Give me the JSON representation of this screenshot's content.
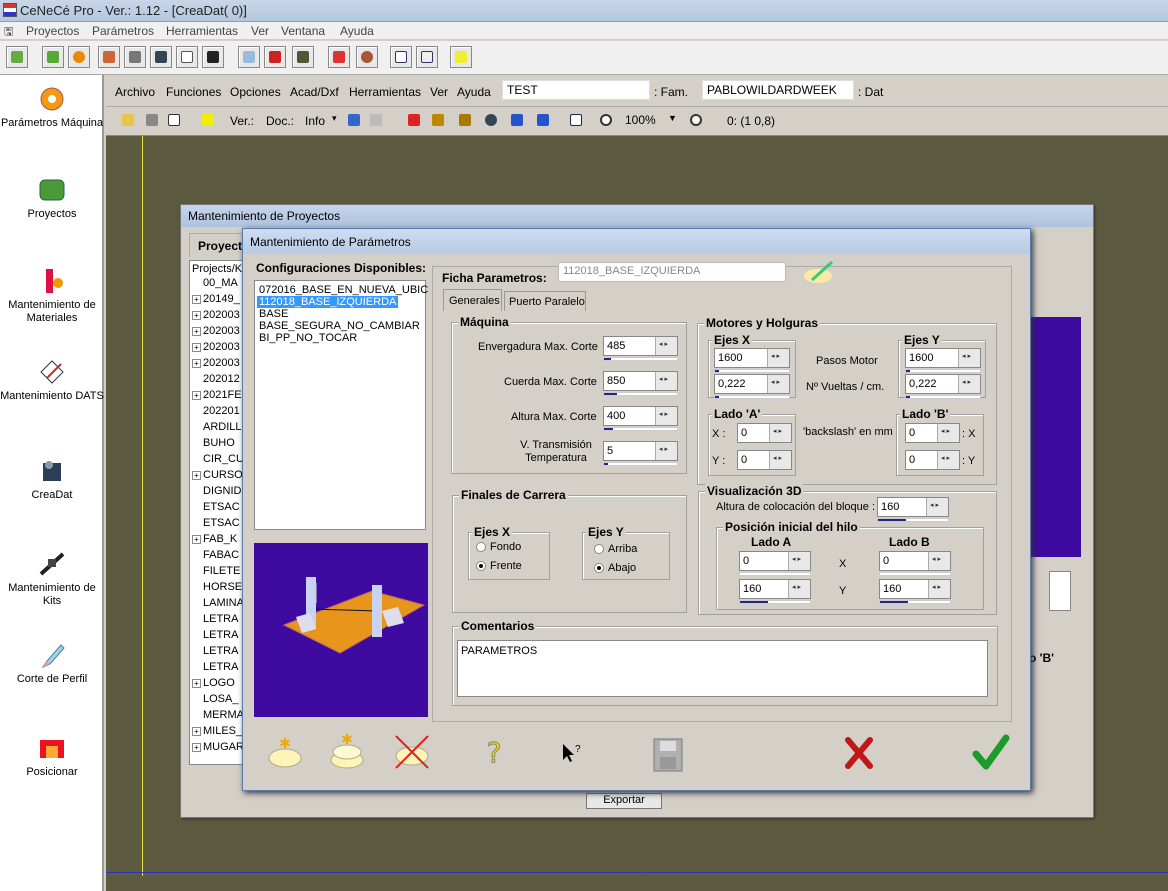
{
  "app": {
    "title": "CeNeCé Pro - Ver.: 1.12 - [CreaDat( 0)]"
  },
  "menubar": [
    "Proyectos",
    "Parámetros",
    "Herramientas",
    "Ver",
    "Ventana",
    "Ayuda"
  ],
  "left_panel": [
    {
      "label": "Parámetros Máquina",
      "icon": "gear-icon"
    },
    {
      "label": "Proyectos",
      "icon": "folder-icon"
    },
    {
      "label": "Mantenimiento de Materiales",
      "icon": "material-icon"
    },
    {
      "label": "Mantenimiento DATS",
      "icon": "dats-icon"
    },
    {
      "label": "CreaDat",
      "icon": "creadat-icon"
    },
    {
      "label": "Mantenimiento de Kits",
      "icon": "kits-icon"
    },
    {
      "label": "Corte de Perfil",
      "icon": "cut-icon"
    },
    {
      "label": "Posicionar",
      "icon": "position-icon"
    }
  ],
  "inner_menu": [
    "Archivo",
    "Funciones",
    "Opciones",
    "Acad/Dxf",
    "Herramientas",
    "Ver",
    "Ayuda"
  ],
  "inner_fields": {
    "fam_value": "TEST",
    "fam_label": ": Fam.",
    "dat_value": "PABLOWILDARDWEEK",
    "dat_label": ": Dat"
  },
  "toolbar2": {
    "ver": "Ver.:",
    "doc": "Doc.:",
    "info": "Info",
    "zoom": "100%",
    "coords": "0: (1 0,8)"
  },
  "proyectos_win": {
    "title": "Mantenimiento de Proyectos",
    "tab": "Proyect",
    "tree_header": "Projects/K",
    "tree": [
      {
        "t": "00_MA",
        "e": false
      },
      {
        "t": "20149_",
        "e": true
      },
      {
        "t": "202003",
        "e": true
      },
      {
        "t": "202003",
        "e": true
      },
      {
        "t": "202003",
        "e": true
      },
      {
        "t": "202003",
        "e": true
      },
      {
        "t": "202012",
        "e": false
      },
      {
        "t": "2021FE",
        "e": true
      },
      {
        "t": "202201",
        "e": false
      },
      {
        "t": "ARDILL",
        "e": false
      },
      {
        "t": "BUHO",
        "e": false
      },
      {
        "t": "CIR_CU",
        "e": false
      },
      {
        "t": "CURSO",
        "e": true
      },
      {
        "t": "DIGNID",
        "e": false
      },
      {
        "t": "ETSAC",
        "e": false
      },
      {
        "t": "ETSAC",
        "e": false
      },
      {
        "t": "FAB_K",
        "e": true
      },
      {
        "t": "FABAC",
        "e": false
      },
      {
        "t": "FILETE",
        "e": false
      },
      {
        "t": "HORSE",
        "e": false
      },
      {
        "t": "LAMINA",
        "e": false
      },
      {
        "t": "LETRA",
        "e": false
      },
      {
        "t": "LETRA",
        "e": false
      },
      {
        "t": "LETRA",
        "e": false
      },
      {
        "t": "LETRA",
        "e": false
      },
      {
        "t": "LOGO",
        "e": true
      },
      {
        "t": "LOSA_",
        "e": false
      },
      {
        "t": "MERMA",
        "e": false
      },
      {
        "t": "MILES_",
        "e": true
      },
      {
        "t": "MUGAR",
        "e": true
      }
    ],
    "export": "Exportar",
    "lado_b": "o 'B'"
  },
  "param_win": {
    "title": "Mantenimiento de Parámetros",
    "configs_label": "Configuraciones Disponibles:",
    "configs": [
      "072016_BASE_EN_NUEVA_UBIC",
      "112018_BASE_IZQUIERDA",
      "BASE",
      "BASE_SEGURA_NO_CAMBIAR",
      "BI_PP_NO_TOCAR"
    ],
    "selected_index": 1,
    "ficha_label": "Ficha Parametros:",
    "ficha_value": "112018_BASE_IZQUIERDA",
    "tabs": [
      "Generales",
      "Puerto Paralelo"
    ],
    "maquina": {
      "title": "Máquina",
      "rows": [
        {
          "label": "Envergadura Max. Corte",
          "value": "485"
        },
        {
          "label": "Cuerda Max. Corte",
          "value": "850"
        },
        {
          "label": "Altura Max. Corte",
          "value": "400"
        },
        {
          "label": "V. Transmisión Temperatura",
          "value": "5"
        }
      ]
    },
    "motores": {
      "title": "Motores y Holguras",
      "ejes_x": "Ejes X",
      "ejes_y": "Ejes Y",
      "pasos_label": "Pasos Motor",
      "vueltas_label": "Nº Vueltas / cm.",
      "x_pasos": "1600",
      "x_vueltas": "0,222",
      "y_pasos": "1600",
      "y_vueltas": "0,222",
      "lado_a": "Lado 'A'",
      "lado_b": "Lado 'B'",
      "backslash": "'backslash' en mm",
      "xa": "0",
      "ya": "0",
      "xb": "0",
      "yb": "0",
      "xl": "X :",
      "yl": "Y :",
      "xr": ": X",
      "yr": ": Y"
    },
    "finales": {
      "title": "Finales de Carrera",
      "ejes_x": "Ejes X",
      "ejes_y": "Ejes Y",
      "fondo": "Fondo",
      "frente": "Frente",
      "arriba": "Arriba",
      "abajo": "Abajo"
    },
    "vis": {
      "title": "Visualización 3D",
      "altura_label": "Altura de colocación del bloque :",
      "altura": "160",
      "pos_title": "Posición inicial del hilo",
      "lado_a": "Lado A",
      "lado_b": "Lado B",
      "x": "X",
      "y": "Y",
      "ax": "0",
      "ay": "160",
      "bx": "0",
      "by": "160"
    },
    "comentarios": {
      "title": "Comentarios",
      "text": "PARAMETROS"
    }
  }
}
